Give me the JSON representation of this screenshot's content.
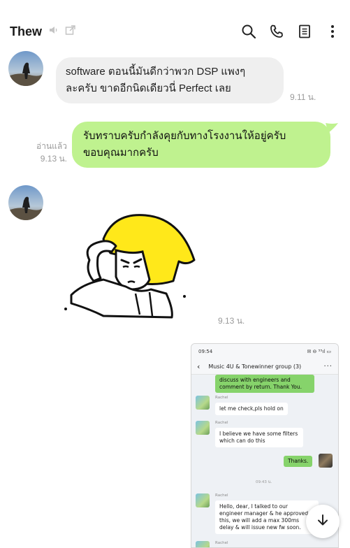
{
  "header": {
    "title": "Thew",
    "icons": [
      "speaker-muted-icon",
      "external-link-icon",
      "search-icon",
      "phone-icon",
      "notes-icon",
      "more-vertical-icon"
    ]
  },
  "messages": [
    {
      "id": "m1",
      "side": "incoming",
      "lines": [
        "software ตอนนี้มันดีกว่าพวก DSP แพงๆ",
        "ละครับ ขาดอีกนิดเดียวนี่ Perfect เลย"
      ],
      "time": "9.11 น."
    },
    {
      "id": "m2",
      "side": "outgoing",
      "lines": [
        "รับทราบครับกำลังคุยกับทางโรงงานให้อยู่ครับ",
        "ขอบคุณมากครับ"
      ],
      "read_label": "อ่านแล้ว",
      "time": "9.13 น."
    },
    {
      "id": "m3",
      "side": "incoming",
      "type": "sticker",
      "time": "9.13 น."
    }
  ],
  "screenshot": {
    "status_time": "09:54",
    "status_right": "✉ ⊖ ⁵⁵ıl ▭",
    "chat_title": "Music 4U & Tonewinner group (3)",
    "msg_top": [
      "discuss with engineers and",
      "comment by return.  Thank You."
    ],
    "sender": "Rachel",
    "msg1": "let me check,pls hold on",
    "msg2": [
      "I believe we have some filters",
      "which can do this"
    ],
    "msg3": "Thanks.",
    "time_divider": "09:43 น.",
    "msg4": [
      "Hello, dear, I talked to our",
      "engineer manager & he approved",
      "this, we will add a max 300ms",
      "delay & will issue new fw soon."
    ]
  },
  "scroll_down_icon": "arrow-down-icon",
  "colors": {
    "incoming_bubble": "#efefef",
    "outgoing_bubble": "#bff28f",
    "timestamp": "#9a9a9a"
  }
}
